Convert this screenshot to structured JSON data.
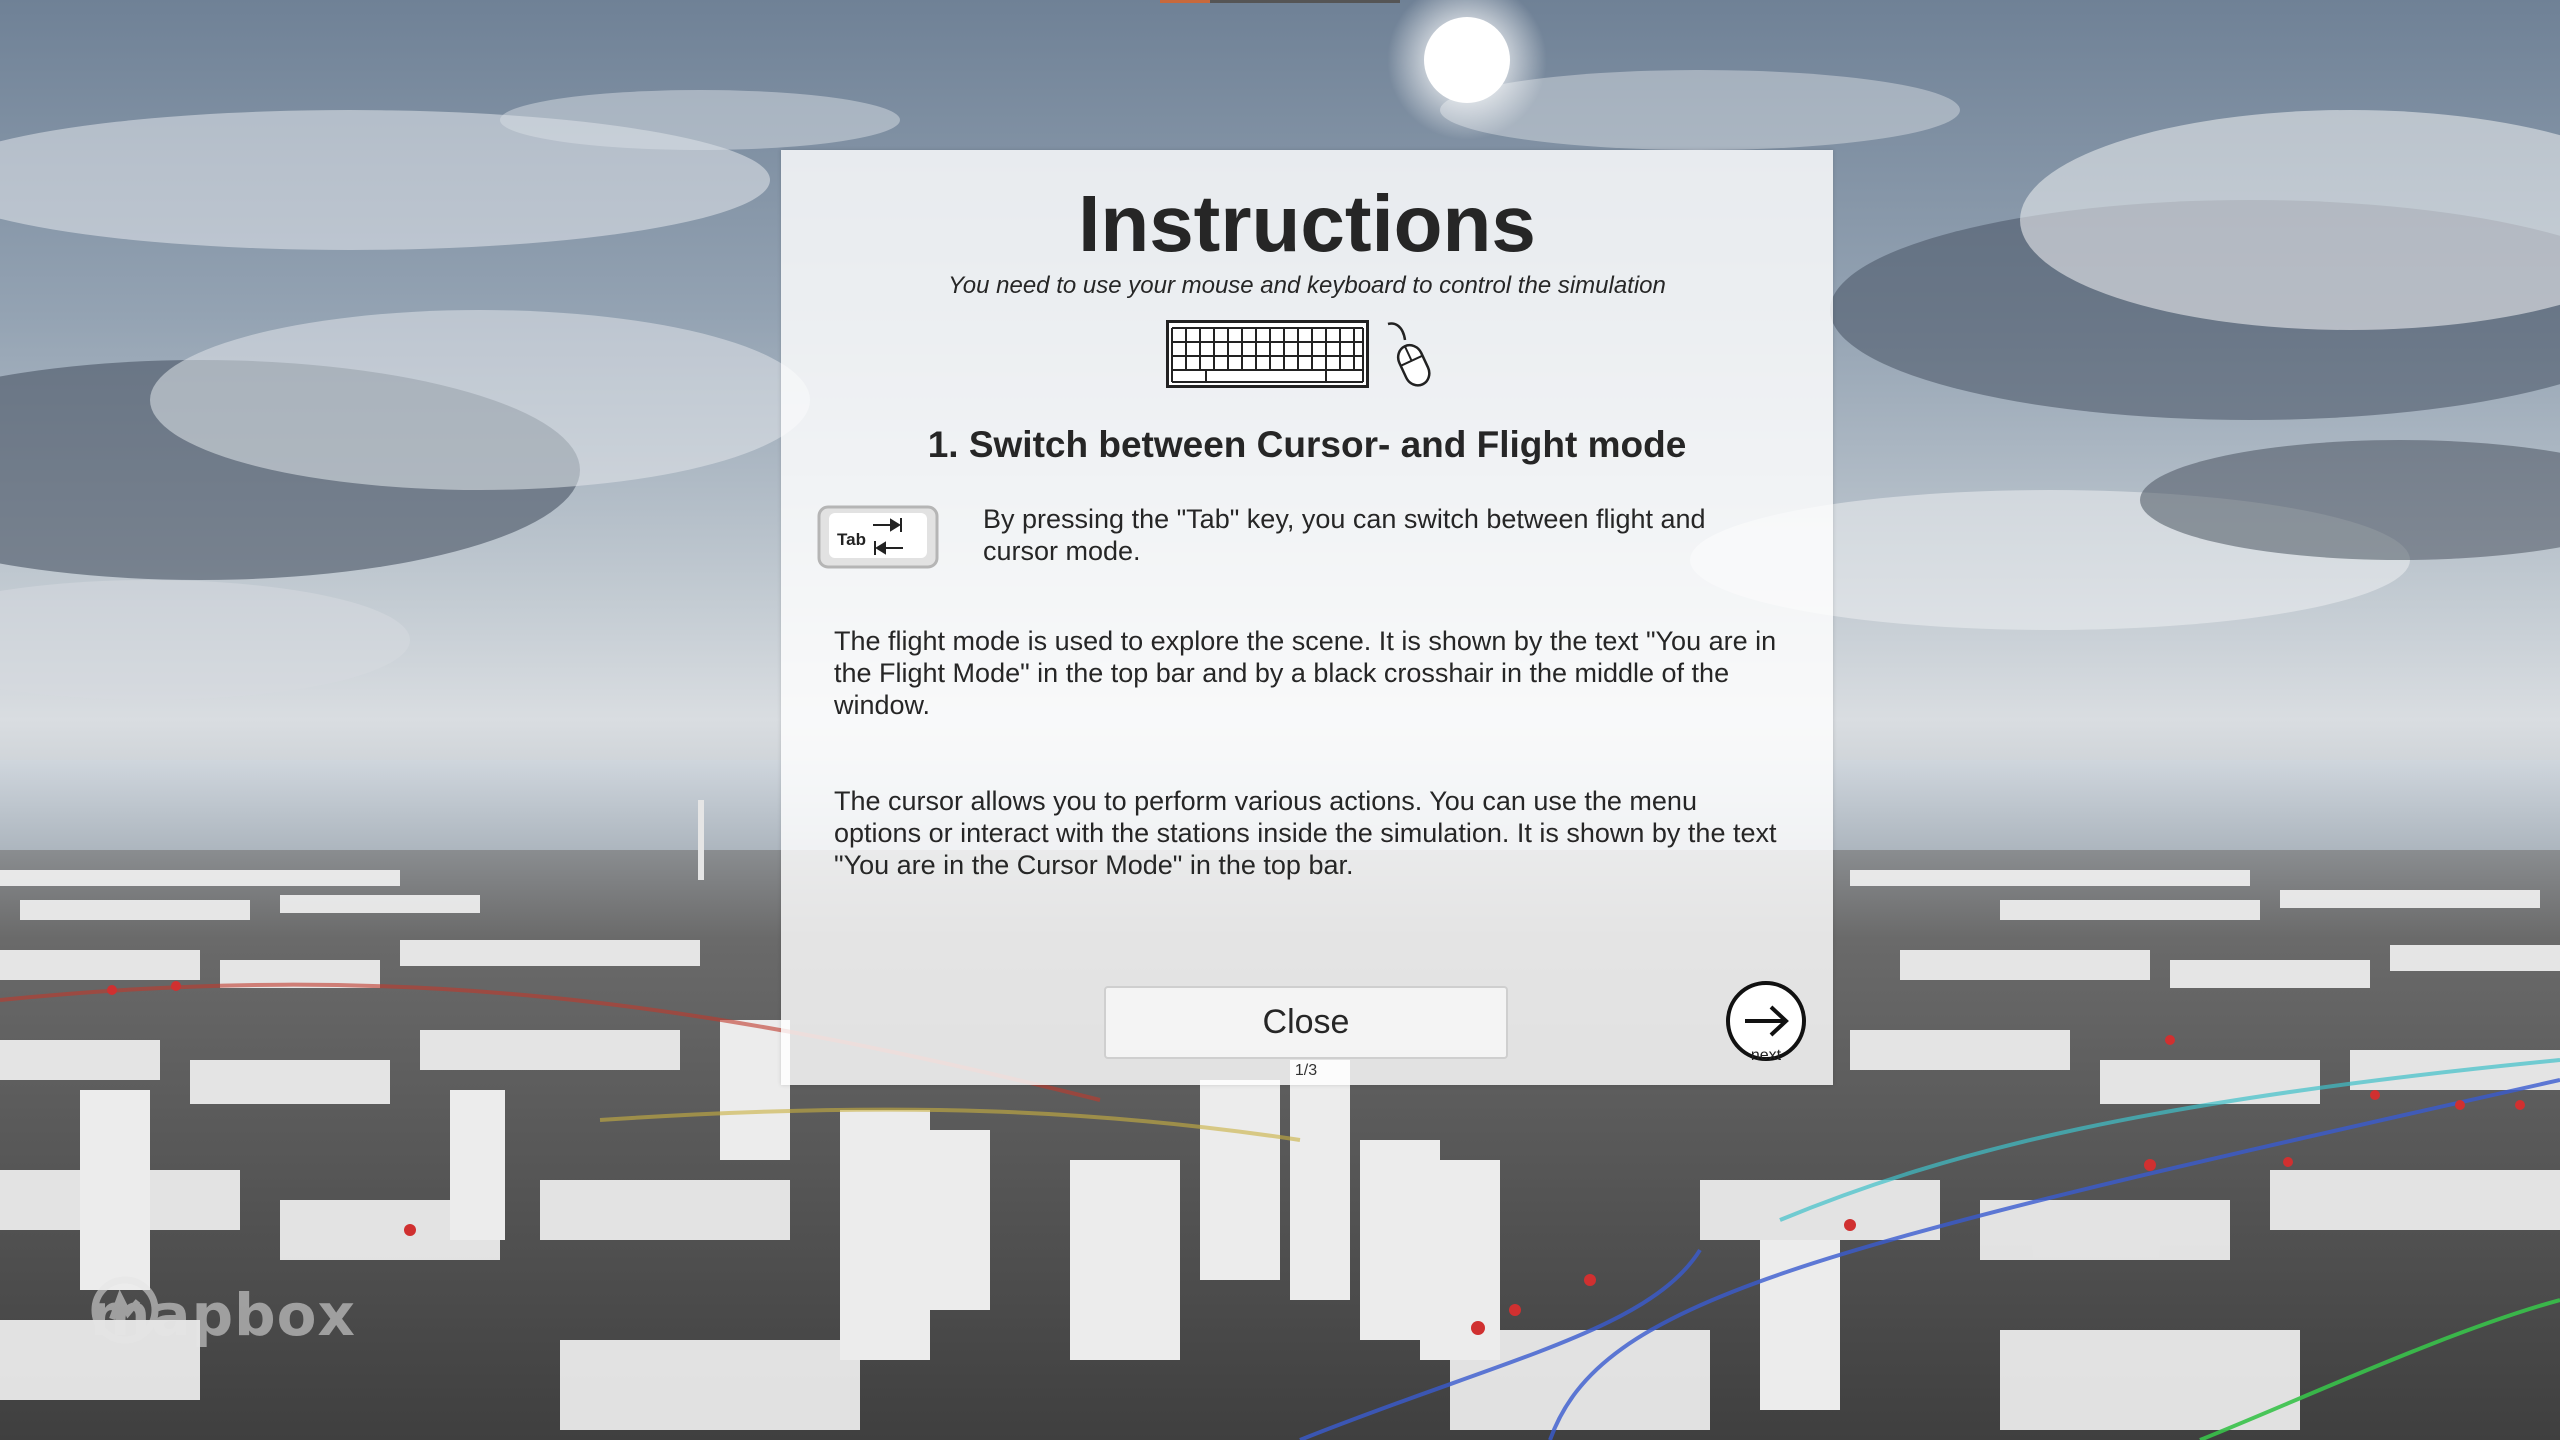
{
  "dialog": {
    "title": "Instructions",
    "subtitle": "You need to use your mouse and keyboard to control the simulation",
    "section_heading": "1. Switch between Cursor- and Flight mode",
    "tab_key_label": "Tab",
    "tab_description": "By pressing the \"Tab\" key, you can switch between flight and cursor mode.",
    "flight_description": "The flight mode is used to explore the scene. It is shown by the text \"You are in the Flight Mode\" in the top bar and by a black crosshair in the middle of the window.",
    "cursor_description": "The cursor allows you to perform various actions. You can use the menu options or interact with the stations inside the simulation. It is shown by the text \"You are in the Cursor Mode\" in the top bar.",
    "close_label": "Close",
    "page_indicator": "1/3",
    "next_label": "next",
    "icons": [
      "keyboard-icon",
      "mouse-icon",
      "tab-key-icon",
      "arrow-right-icon"
    ]
  },
  "watermark": {
    "brand": "mapbox"
  },
  "colors": {
    "panel_background": "#ffffff",
    "text": "#262626",
    "button_border": "#cfcfcf",
    "route_red": "#c0392b",
    "route_blue": "#3a5bd0",
    "route_green": "#39c24a"
  }
}
